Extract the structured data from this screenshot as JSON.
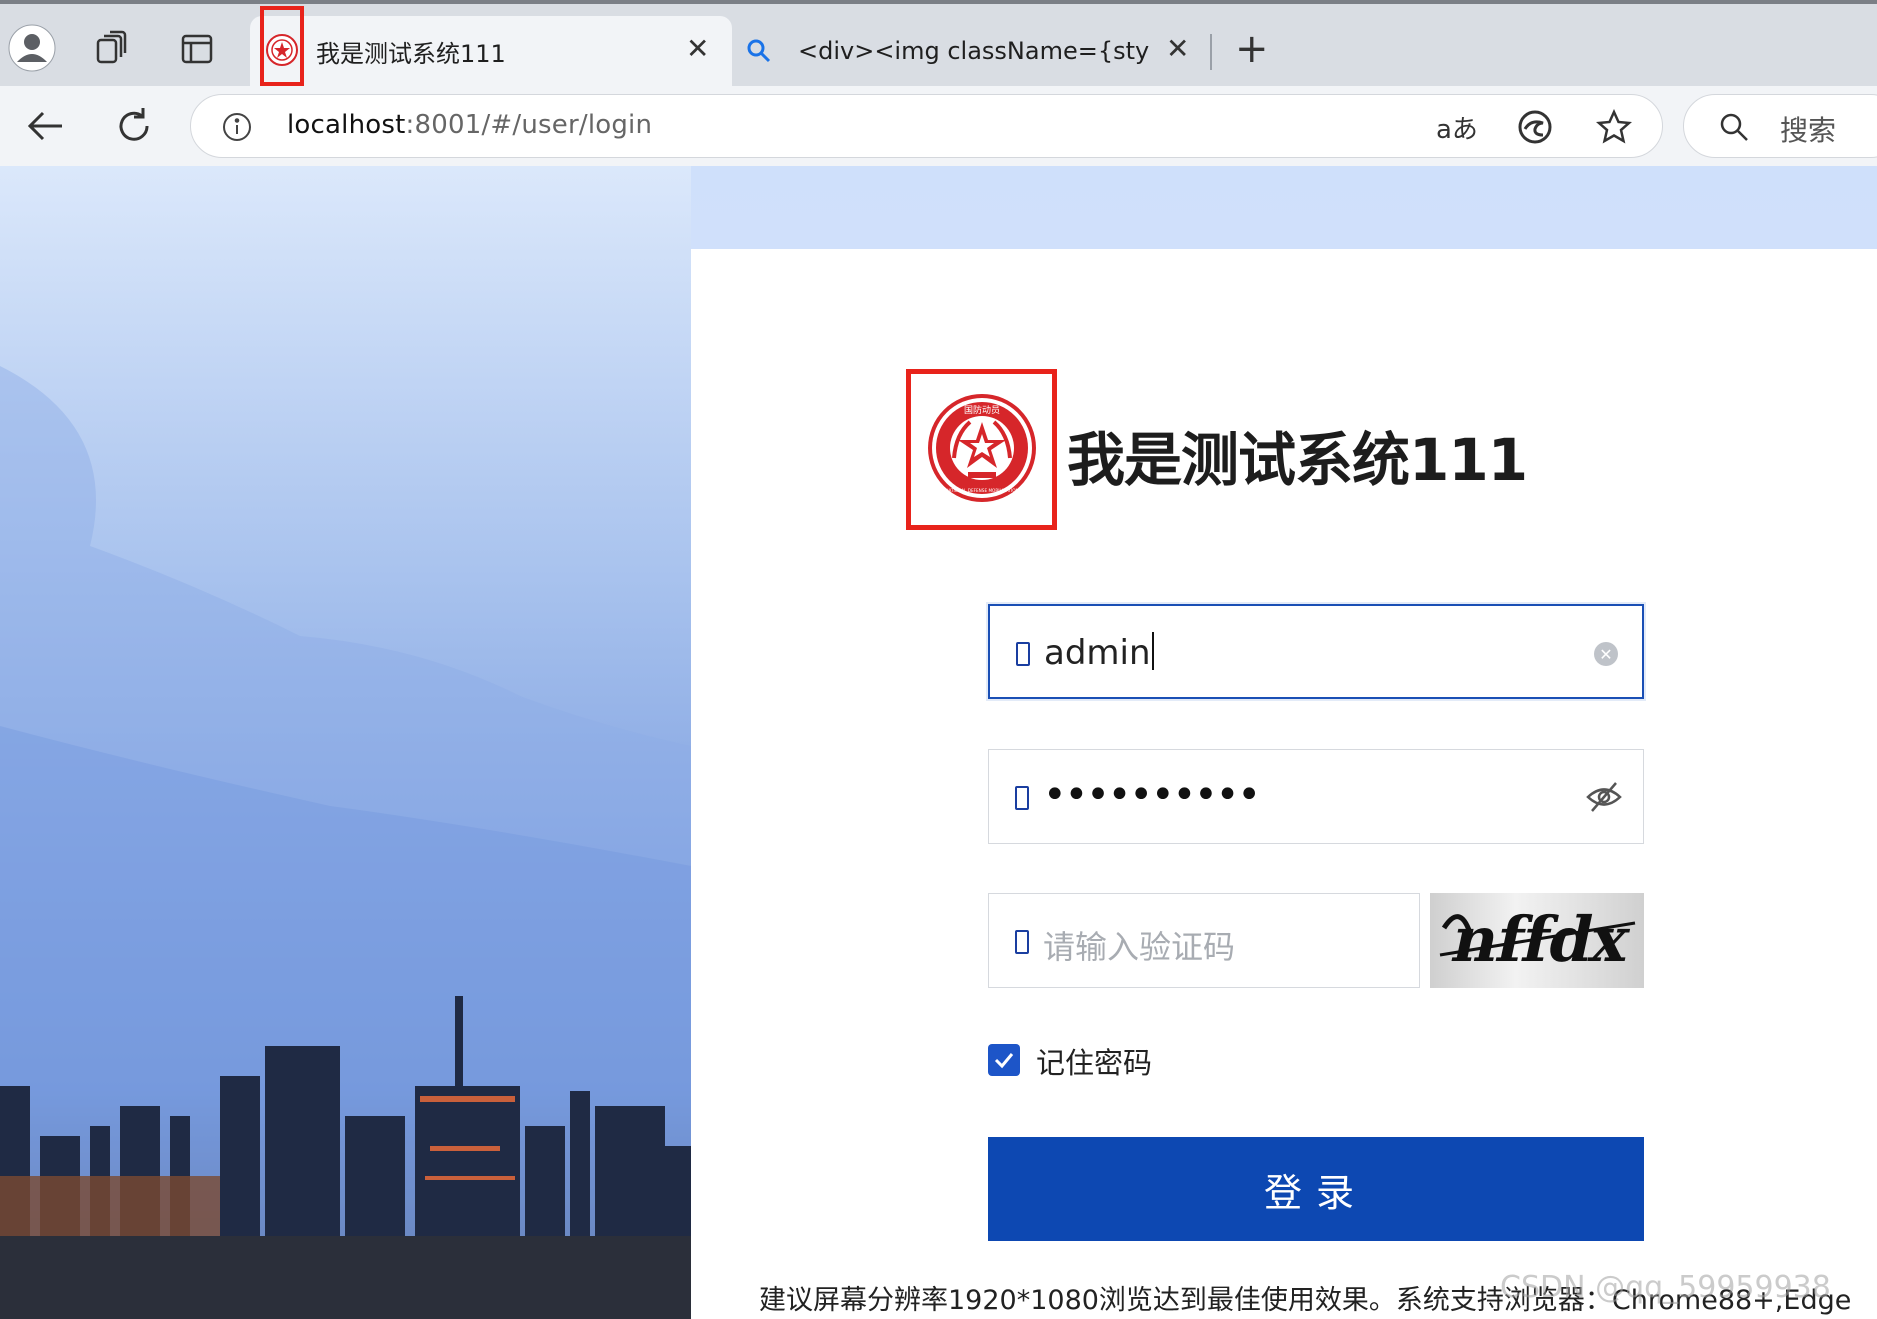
{
  "browser": {
    "tabs": [
      {
        "title": "我是测试系统111",
        "active": true
      },
      {
        "title": "<div><img className={styles.lo",
        "active": false
      }
    ],
    "address": {
      "host": "localhost",
      "path": ":8001/#/user/login"
    },
    "search_label": "搜索",
    "translate_label": "aあ"
  },
  "login": {
    "system_title": "我是测试系统111",
    "logo_top_text": "国防动员",
    "logo_bottom_text": "NATIONAL DEFENSE MOBILIZATION",
    "username_value": "admin",
    "password_mask": "••••••••••",
    "captcha_placeholder": "请输入验证码",
    "captcha_code": "nffdx",
    "remember_label": "记住密码",
    "remember_checked": true,
    "submit_label": "登录",
    "footer_note": "建议屏幕分辨率1920*1080浏览达到最佳使用效果。系统支持浏览器：Chrome88+,Edge",
    "watermark": "CSDN @qq_59959938"
  },
  "colors": {
    "primary": "#0d48b2",
    "highlight_box": "#e8231b",
    "emblem_red": "#d6262a"
  }
}
